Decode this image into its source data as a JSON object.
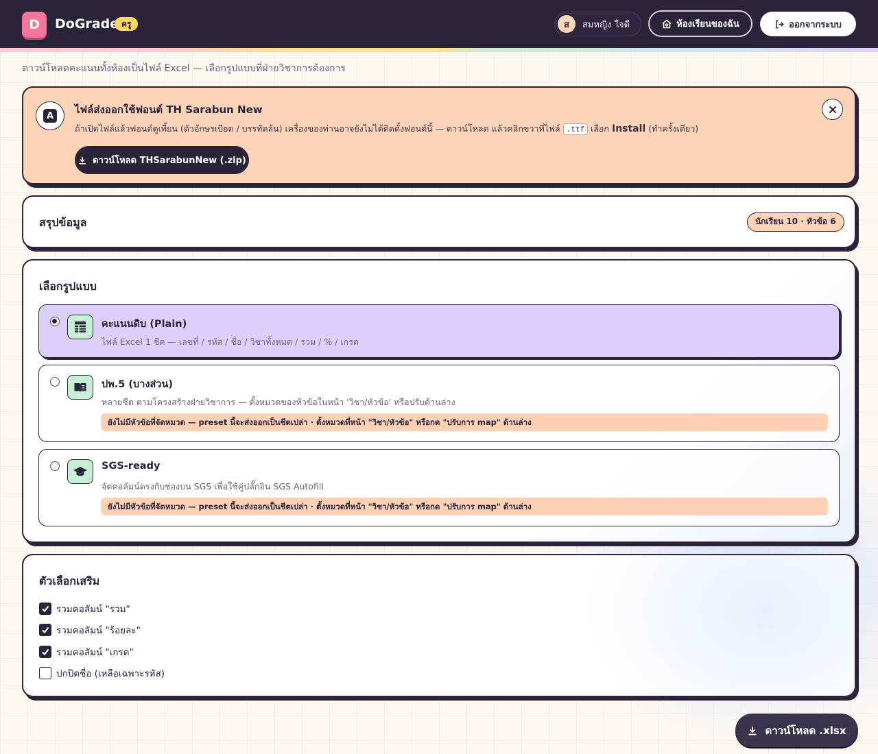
{
  "header": {
    "logo_letter": "D",
    "app_name": "DoGrade",
    "role_badge": "ครู",
    "user_initial": "ส",
    "user_name": "สมหญิง ใจดี",
    "my_class_label": "ห้องเรียนของฉัน",
    "logout_label": "ออกจากระบบ"
  },
  "page": {
    "subtitle": "ดาวน์โหลดคะแนนทั้งห้องเป็นไฟล์ Excel — เลือกรูปแบบที่ฝ่ายวิชาการต้องการ"
  },
  "font_notice": {
    "icon_letter": "A",
    "title": "ไฟล์ส่งออกใช้ฟอนต์ TH Sarabun New",
    "desc_before": "ถ้าเปิดไฟล์แล้วฟอนต์ดูเพี้ยน (ตัวอักษรเบียด / บรรทัดล้น) เครื่องของท่านอาจยังไม่ได้ติดตั้งฟอนต์นี้ — ดาวน์โหลด แล้วคลิกขวาที่ไฟล์",
    "desc_code": ".ttf",
    "desc_mid": "เลือก",
    "desc_bold": "Install",
    "desc_after": "(ทำครั้งเดียว)",
    "download_zip_label": "ดาวน์โหลด THSarabunNew (.zip)"
  },
  "summary": {
    "title": "สรุปข้อมูล",
    "badge": "นักเรียน 10 · หัวข้อ 6"
  },
  "format": {
    "title": "เลือกรูปแบบ",
    "options": [
      {
        "title": "คะแนนดิบ (Plain)",
        "desc": "ไฟล์ Excel 1 ชีต — เลขที่ / รหัส / ชื่อ / วิชาทั้งหมด / รวม / % / เกรด",
        "selected": true,
        "icon": "table-icon"
      },
      {
        "title": "ปพ.5 (บางส่วน)",
        "desc": "หลายชีต ตามโครงสร้างฝ่ายวิชาการ — ตั้งหมวดของหัวข้อในหน้า 'วิชา/หัวข้อ' หรือปรับด้านล่าง",
        "warning": "ยังไม่มีหัวข้อที่จัดหมวด — preset นี้จะส่งออกเป็นชีตเปล่า · ตั้งหมวดที่หน้า \"วิชา/หัวข้อ\" หรือกด \"ปรับการ map\" ด้านล่าง",
        "selected": false,
        "icon": "book-icon"
      },
      {
        "title": "SGS-ready",
        "desc": "จัดคอลัมน์ตรงกับช่องบน SGS เพื่อใช้คู่ปลั๊กอิน SGS Autofill",
        "warning": "ยังไม่มีหัวข้อที่จัดหมวด — preset นี้จะส่งออกเป็นชีตเปล่า · ตั้งหมวดที่หน้า \"วิชา/หัวข้อ\" หรือกด \"ปรับการ map\" ด้านล่าง",
        "selected": false,
        "icon": "graduation-cap-icon"
      }
    ]
  },
  "extra_options": {
    "title": "ตัวเลือกเสริม",
    "items": [
      {
        "label": "รวมคอลัมน์ \"รวม\"",
        "checked": true
      },
      {
        "label": "รวมคอลัมน์ \"ร้อยละ\"",
        "checked": true
      },
      {
        "label": "รวมคอลัมน์ \"เกรด\"",
        "checked": true
      },
      {
        "label": "ปกปิดชื่อ (เหลือเฉพาะรหัส)",
        "checked": false
      }
    ]
  },
  "download_button_label": "ดาวน์โหลด .xlsx",
  "colors": {
    "dark": "#2b2338",
    "accent_pink": "#f4769a",
    "badge_yellow": "#fbd661",
    "notice_peach": "#fdd4b8",
    "selected_lavender": "#dcd0fb",
    "icon_mint": "#c6efd4"
  }
}
